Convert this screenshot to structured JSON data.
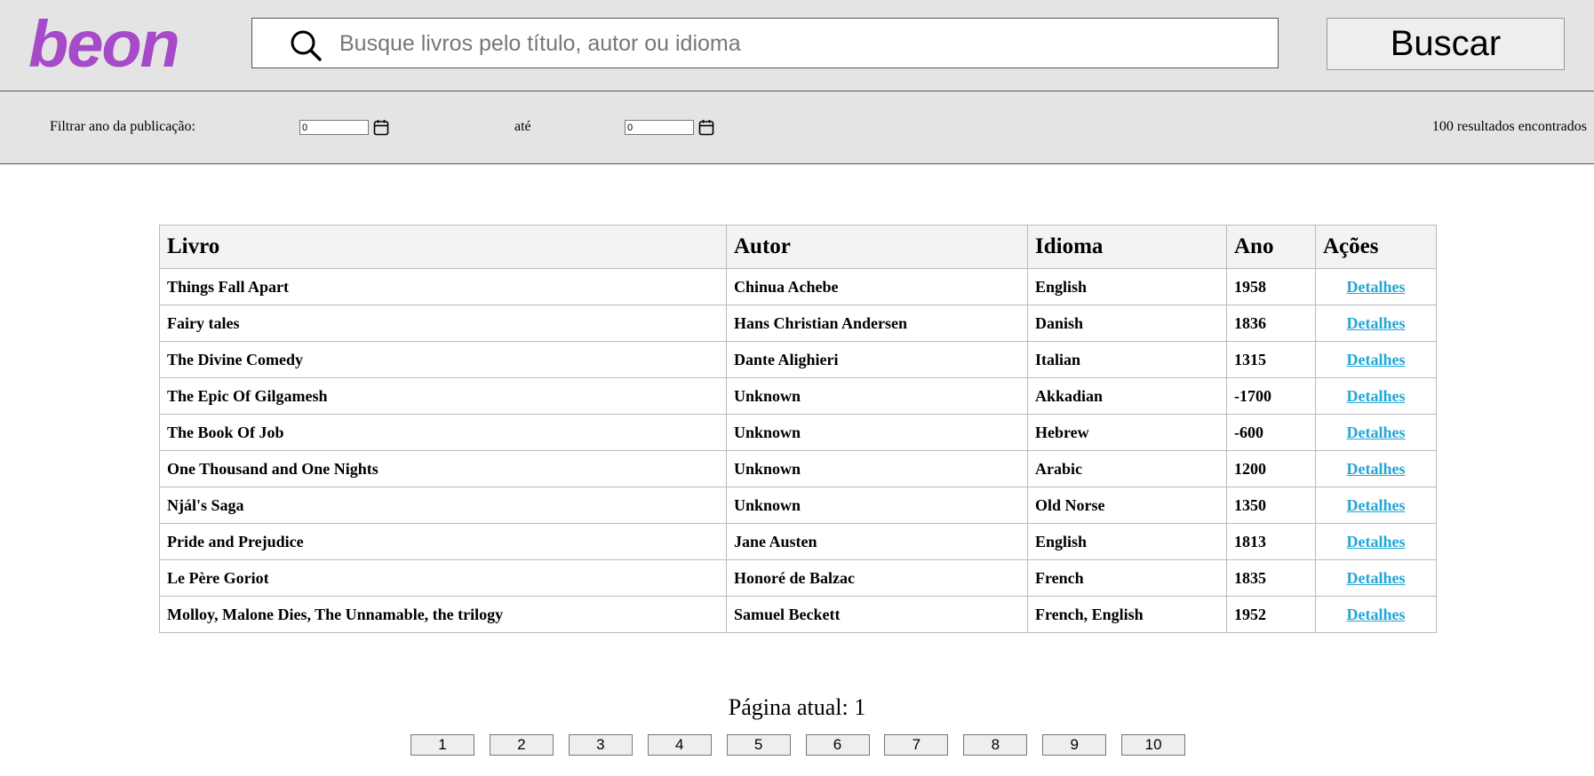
{
  "header": {
    "logo_text": "beon",
    "search_placeholder": "Busque livros pelo título, autor ou idioma",
    "search_value": "",
    "search_button_label": "Buscar"
  },
  "filters": {
    "year_label": "Filtrar ano da publicação:",
    "from_value": "0",
    "to_label": "até",
    "to_value": "0",
    "results_text": "100 resultados encontrados"
  },
  "table": {
    "headers": [
      "Livro",
      "Autor",
      "Idioma",
      "Ano",
      "Ações"
    ],
    "rows": [
      {
        "book": "Things Fall Apart",
        "author": "Chinua Achebe",
        "language": "English",
        "year": "1958",
        "action": "Detalhes"
      },
      {
        "book": "Fairy tales",
        "author": "Hans Christian Andersen",
        "language": "Danish",
        "year": "1836",
        "action": "Detalhes"
      },
      {
        "book": "The Divine Comedy",
        "author": "Dante Alighieri",
        "language": "Italian",
        "year": "1315",
        "action": "Detalhes"
      },
      {
        "book": "The Epic Of Gilgamesh",
        "author": "Unknown",
        "language": "Akkadian",
        "year": "-1700",
        "action": "Detalhes"
      },
      {
        "book": "The Book Of Job",
        "author": "Unknown",
        "language": "Hebrew",
        "year": "-600",
        "action": "Detalhes"
      },
      {
        "book": "One Thousand and One Nights",
        "author": "Unknown",
        "language": "Arabic",
        "year": "1200",
        "action": "Detalhes"
      },
      {
        "book": "Njál's Saga",
        "author": "Unknown",
        "language": "Old Norse",
        "year": "1350",
        "action": "Detalhes"
      },
      {
        "book": "Pride and Prejudice",
        "author": "Jane Austen",
        "language": "English",
        "year": "1813",
        "action": "Detalhes"
      },
      {
        "book": "Le Père Goriot",
        "author": "Honoré de Balzac",
        "language": "French",
        "year": "1835",
        "action": "Detalhes"
      },
      {
        "book": "Molloy, Malone Dies, The Unnamable, the trilogy",
        "author": "Samuel Beckett",
        "language": "French, English",
        "year": "1952",
        "action": "Detalhes"
      }
    ]
  },
  "pagination": {
    "current_label": "Página atual: 1",
    "pages": [
      "1",
      "2",
      "3",
      "4",
      "5",
      "6",
      "7",
      "8",
      "9",
      "10"
    ]
  },
  "icons": {
    "search": "search-icon",
    "calendar": "calendar-icon"
  },
  "colors": {
    "logo": "#a64ac9",
    "link": "#22a7d6",
    "bar_background": "#e4e4e4"
  }
}
